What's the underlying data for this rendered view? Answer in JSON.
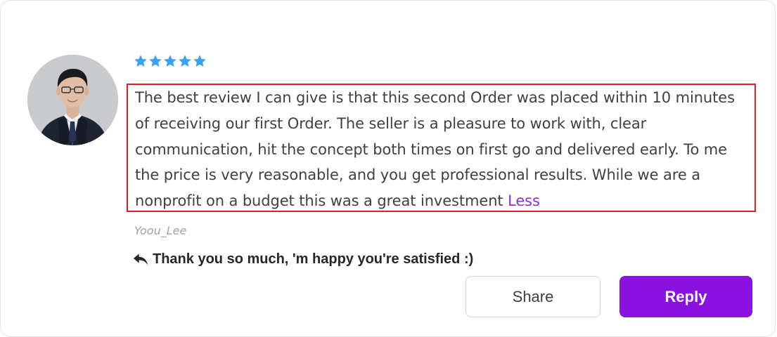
{
  "review": {
    "rating": 5,
    "rating_max": 5,
    "star_color": "#3aa3f0",
    "text": "The best review I can give is that this second Order was placed within 10 minutes of receiving our first Order. The seller is a pleasure to work with, clear communication, hit the concept both times on first go and delivered early. To me the price is very reasonable, and you get professional results. While we are a nonprofit on a budget this was a great investment",
    "less_label": "Less",
    "highlight_color": "#e11d2a",
    "reviewer_name": "Yoou_Lee"
  },
  "seller_reply": {
    "icon": "reply-arrow-icon",
    "text": "Thank you so much, 'm happy you're satisfied :)"
  },
  "actions": {
    "share_label": "Share",
    "reply_label": "Reply",
    "reply_color": "#8a12e0"
  }
}
